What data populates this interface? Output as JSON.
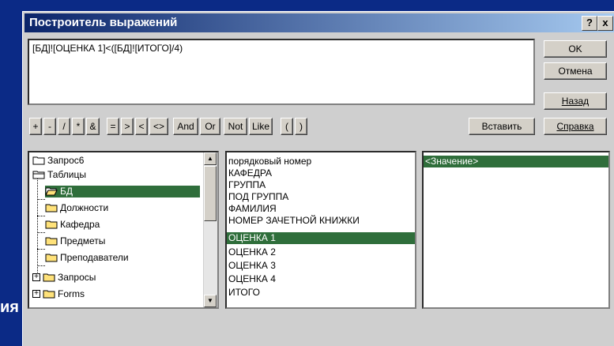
{
  "background_text": "ия",
  "dialog": {
    "title": "Построитель выражений",
    "help_button": "?",
    "close_button": "x",
    "expression": "[БД]![ОЦЕНКА 1]<([БД]![ИТОГО]/4)"
  },
  "buttons": {
    "ok": "OK",
    "cancel": "Отмена",
    "back": "Назад",
    "help": "Справка",
    "insert": "Вставить"
  },
  "operators": [
    "+",
    "-",
    "/",
    "*",
    "&",
    "=",
    ">",
    "<",
    "<>",
    "And",
    "Or",
    "Not",
    "Like",
    "(",
    ")"
  ],
  "tree": {
    "items": [
      {
        "label": "Запрос6",
        "kind": "folder"
      },
      {
        "label": "Таблицы",
        "kind": "folder-open"
      },
      {
        "label": "БД",
        "kind": "folder-open",
        "selected": true
      },
      {
        "label": "Должности",
        "kind": "folder"
      },
      {
        "label": "Кафедра",
        "kind": "folder"
      },
      {
        "label": "Предметы",
        "kind": "folder"
      },
      {
        "label": "Преподаватели",
        "kind": "folder"
      },
      {
        "label": "Запросы",
        "kind": "plus"
      },
      {
        "label": "Forms",
        "kind": "plus"
      }
    ]
  },
  "fields": [
    "порядковый номер",
    "КАФЕДРА",
    "ГРУППА",
    "ПОД ГРУППА",
    "ФАМИЛИЯ",
    "НОМЕР ЗАЧЕТНОЙ КНИЖКИ",
    "ОЦЕНКА 1",
    "ОЦЕНКА 2",
    "ОЦЕНКА 3",
    "ОЦЕНКА 4",
    "ИТОГО"
  ],
  "selected_field": "ОЦЕНКА 1",
  "values": [
    "<Значение>"
  ],
  "colors": {
    "selection": "#2f6e3b",
    "title_start": "#0a246a",
    "title_end": "#a6caf0",
    "desktop": "#0b2a86"
  }
}
